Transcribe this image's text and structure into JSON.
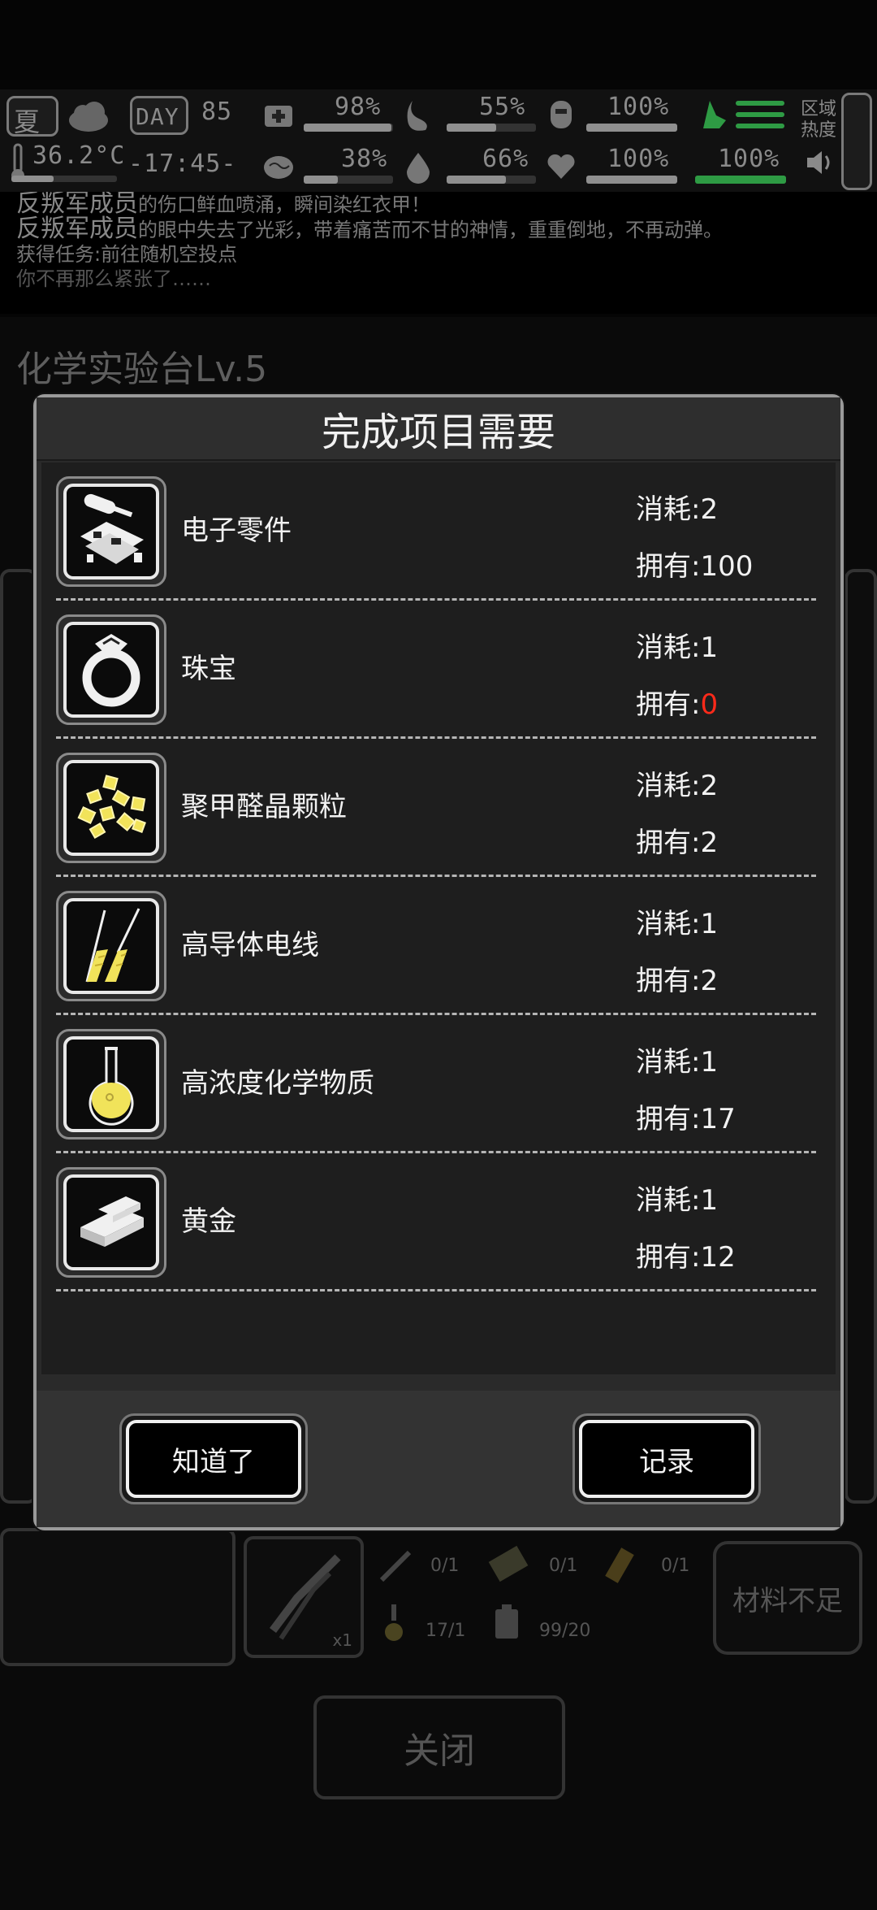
{
  "hud": {
    "season": "夏",
    "day_label": "DAY",
    "day_number": "85",
    "temperature": "36.2°C",
    "clock": "-17:45-",
    "stats_top": [
      "98%",
      "55%",
      "100%"
    ],
    "stats_bottom": [
      "38%",
      "66%",
      "100%",
      "100%"
    ],
    "zone_label": "区域热度"
  },
  "log": {
    "lines": [
      {
        "em": "反叛军成员",
        "text": "的伤口鲜血喷涌，瞬间染红衣甲！"
      },
      {
        "em": "反叛军成员",
        "text": "的眼中失去了光彩，带着痛苦而不甘的神情，重重倒地，不再动弹。"
      },
      {
        "em": "",
        "text": "获得任务:前往随机空投点"
      },
      {
        "em": "",
        "text": "你不再那么紧张了……"
      }
    ]
  },
  "background": {
    "lab_title": "化学实验台Lv.5",
    "materials": [
      "0/1",
      "0/1",
      "0/1",
      "17/1",
      "99/20"
    ],
    "crafting_count": "x1",
    "insufficient_label": "材料不足",
    "close_label": "关闭"
  },
  "modal": {
    "title": "完成项目需要",
    "items": [
      {
        "name": "电子零件",
        "cost_label": "消耗:2",
        "own_prefix": "拥有:",
        "own_value": "100",
        "short": false,
        "icon": "electronic-parts-icon"
      },
      {
        "name": "珠宝",
        "cost_label": "消耗:1",
        "own_prefix": "拥有:",
        "own_value": "0",
        "short": true,
        "icon": "jewel-ring-icon"
      },
      {
        "name": "聚甲醛晶颗粒",
        "cost_label": "消耗:2",
        "own_prefix": "拥有:",
        "own_value": "2",
        "short": false,
        "icon": "crystal-granules-icon"
      },
      {
        "name": "高导体电线",
        "cost_label": "消耗:1",
        "own_prefix": "拥有:",
        "own_value": "2",
        "short": false,
        "icon": "conductor-wire-icon"
      },
      {
        "name": "高浓度化学物质",
        "cost_label": "消耗:1",
        "own_prefix": "拥有:",
        "own_value": "17",
        "short": false,
        "icon": "chemical-flask-icon"
      },
      {
        "name": "黄金",
        "cost_label": "消耗:1",
        "own_prefix": "拥有:",
        "own_value": "12",
        "short": false,
        "icon": "gold-bars-icon"
      }
    ],
    "ok_label": "知道了",
    "record_label": "记录"
  },
  "colors": {
    "short_amount": "#ff2a1a",
    "icon_yellow": "#f1e35a",
    "hud_green": "#2e9b44"
  }
}
